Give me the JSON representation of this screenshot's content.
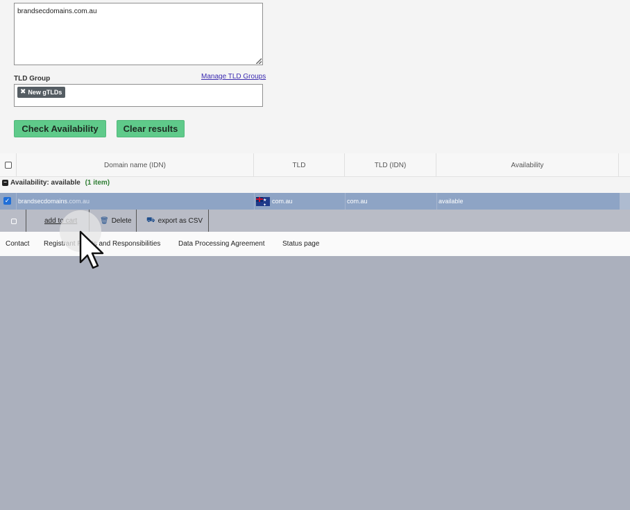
{
  "form": {
    "domain_input_value": "brandsecdomains.com.au",
    "tld_group_label": "TLD Group",
    "manage_tld_groups_link": "Manage TLD Groups",
    "selected_tld_group_tag": "New gTLDs",
    "check_availability_label": "Check Availability",
    "clear_results_label": "Clear results"
  },
  "table": {
    "columns": [
      "Domain name (IDN)",
      "TLD",
      "TLD (IDN)",
      "Availability"
    ],
    "group": {
      "label": "Availability: available",
      "count": "(1 item)"
    },
    "rows": [
      {
        "domain": "brandsecdomains",
        "domain_suffix": ".com.au",
        "tld": "com.au",
        "tld_idn": "com.au",
        "availability": "available",
        "selected": true
      }
    ]
  },
  "actions": {
    "add_to_cart_label": "add to cart",
    "delete_label": "Delete",
    "export_csv_label": "export as CSV"
  },
  "footer": {
    "links": [
      "Contact",
      "Registrant Rights and Responsibilities",
      "Data Processing Agreement",
      "Status page"
    ]
  },
  "colors": {
    "accent_green": "#5fca8a",
    "selected_row": "#8ea4c5",
    "page_overlay": "#abb0bd"
  }
}
